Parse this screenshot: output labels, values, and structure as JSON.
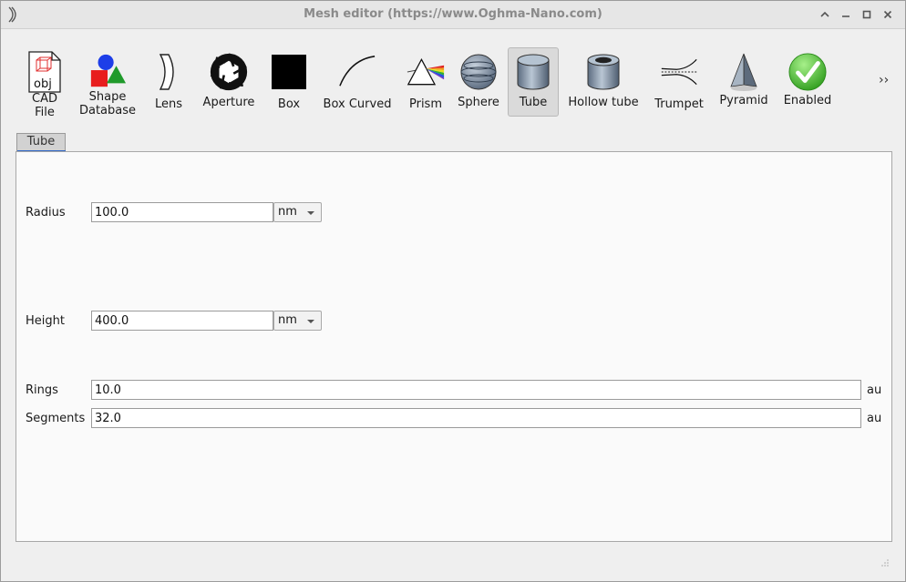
{
  "window": {
    "title": "Mesh editor (https://www.Oghma-Nano.com)"
  },
  "toolbar": {
    "items": [
      {
        "label": "CAD\nFile",
        "icon": "cad-file-icon"
      },
      {
        "label": "Shape\nDatabase",
        "icon": "shape-database-icon"
      },
      {
        "label": "Lens",
        "icon": "lens-icon"
      },
      {
        "label": "Aperture",
        "icon": "aperture-icon"
      },
      {
        "label": "Box",
        "icon": "box-icon"
      },
      {
        "label": "Box Curved",
        "icon": "box-curved-icon"
      },
      {
        "label": "Prism",
        "icon": "prism-icon"
      },
      {
        "label": "Sphere",
        "icon": "sphere-icon"
      },
      {
        "label": "Tube",
        "icon": "tube-icon",
        "active": true
      },
      {
        "label": "Hollow tube",
        "icon": "hollow-tube-icon"
      },
      {
        "label": "Trumpet",
        "icon": "trumpet-icon"
      },
      {
        "label": "Pyramid",
        "icon": "pyramid-icon"
      },
      {
        "label": "Enabled",
        "icon": "enabled-check-icon"
      }
    ],
    "more": "››",
    "cad_obj_text": "obj"
  },
  "tabs": [
    {
      "label": "Tube"
    }
  ],
  "form": {
    "radius": {
      "label": "Radius",
      "value": "100.0",
      "unit": "nm"
    },
    "height": {
      "label": "Height",
      "value": "400.0",
      "unit": "nm"
    },
    "rings": {
      "label": "Rings",
      "value": "10.0",
      "unit": "au"
    },
    "segments": {
      "label": "Segments",
      "value": "32.0",
      "unit": "au"
    }
  }
}
